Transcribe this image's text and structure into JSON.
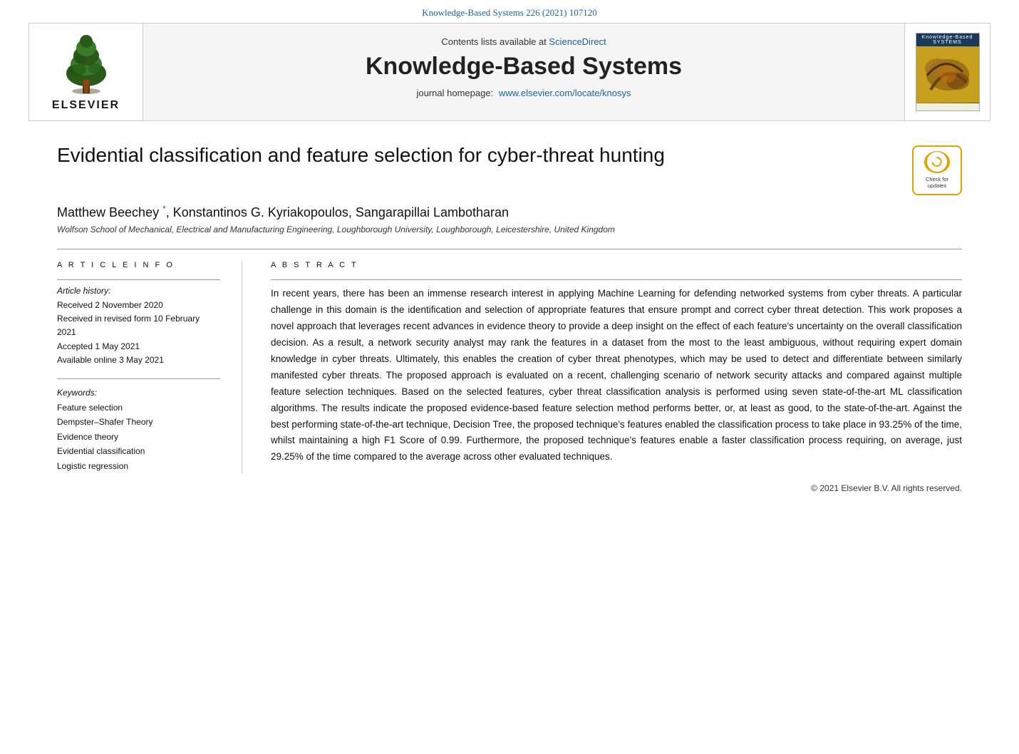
{
  "topRef": {
    "text": "Knowledge-Based Systems 226 (2021) 107120"
  },
  "header": {
    "contentsLine": "Contents lists available at",
    "scienceDirect": "ScienceDirect",
    "journalTitle": "Knowledge-Based Systems",
    "homepageLine": "journal homepage:",
    "homepageUrl": "www.elsevier.com/locate/knosys",
    "elsevierLabel": "ELSEVIER",
    "journalThumbTop": "Knowledge-Based\nSYSTEMS"
  },
  "article": {
    "title": "Evidential classification and feature selection for cyber-threat hunting",
    "authors": "Matthew Beechey *, Konstantinos G. Kyriakopoulos, Sangarapillai Lambotharan",
    "authorSuperscript": "*",
    "affiliation": "Wolfson School of Mechanical, Electrical and Manufacturing Engineering, Loughborough University, Loughborough, Leicestershire, United Kingdom"
  },
  "articleInfo": {
    "sectionHeader": "A R T I C L E   I N F O",
    "historyLabel": "Article history:",
    "received": "Received 2 November 2020",
    "revised": "Received in revised form 10 February 2021",
    "accepted": "Accepted 1 May 2021",
    "online": "Available online 3 May 2021",
    "keywordsLabel": "Keywords:",
    "keywords": [
      "Feature selection",
      "Dempster–Shafer Theory",
      "Evidence theory",
      "Evidential classification",
      "Logistic regression"
    ]
  },
  "abstract": {
    "sectionHeader": "A B S T R A C T",
    "text": "In recent years, there has been an immense research interest in applying Machine Learning for defending networked systems from cyber threats. A particular challenge in this domain is the identification and selection of appropriate features that ensure prompt and correct cyber threat detection. This work proposes a novel approach that leverages recent advances in evidence theory to provide a deep insight on the effect of each feature's uncertainty on the overall classification decision. As a result, a network security analyst may rank the features in a dataset from the most to the least ambiguous, without requiring expert domain knowledge in cyber threats. Ultimately, this enables the creation of cyber threat phenotypes, which may be used to detect and differentiate between similarly manifested cyber threats. The proposed approach is evaluated on a recent, challenging scenario of network security attacks and compared against multiple feature selection techniques. Based on the selected features, cyber threat classification analysis is performed using seven state-of-the-art ML classification algorithms. The results indicate the proposed evidence-based feature selection method performs better, or, at least as good, to the state-of-the-art. Against the best performing state-of-the-art technique, Decision Tree, the proposed technique's features enabled the classification process to take place in 93.25% of the time, whilst maintaining a high F1 Score of 0.99. Furthermore, the proposed technique's features enable a faster classification process requiring, on average, just 29.25% of the time compared to the average across other evaluated techniques."
  },
  "checkUpdates": {
    "line1": "Check for",
    "line2": "updates"
  },
  "copyright": "© 2021 Elsevier B.V. All rights reserved."
}
